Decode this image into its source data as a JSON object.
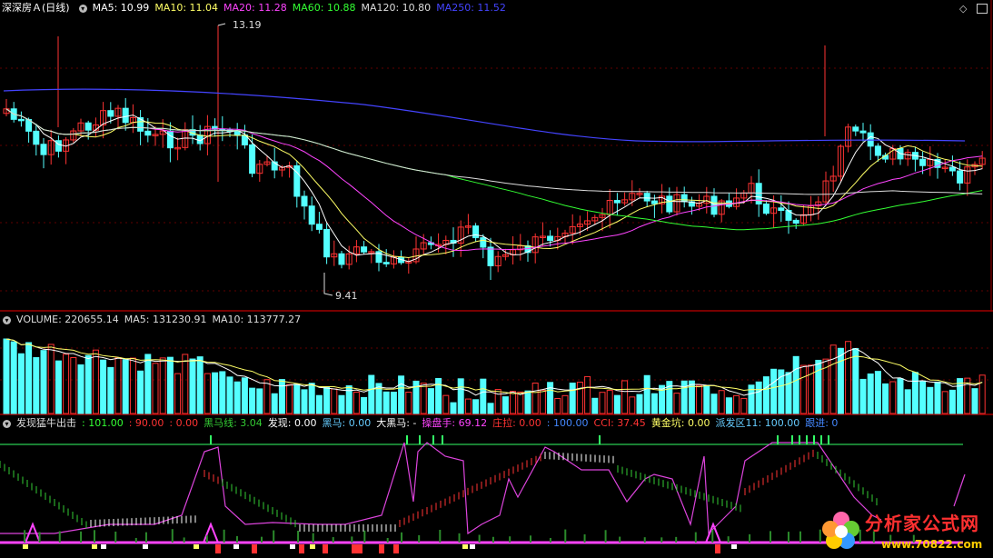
{
  "price_panel": {
    "title": "深深房Ａ(日线)",
    "indicators": [
      {
        "label": "MA5: 10.99",
        "color": "#ffffff"
      },
      {
        "label": "MA10: 11.04",
        "color": "#ffff66"
      },
      {
        "label": "MA20: 11.28",
        "color": "#ff44ff"
      },
      {
        "label": "MA60: 10.88",
        "color": "#33ff33"
      },
      {
        "label": "MA120: 10.80",
        "color": "#dddddd"
      },
      {
        "label": "MA250: 11.52",
        "color": "#4444ff"
      }
    ],
    "high_label": "13.19",
    "low_label": "9.41"
  },
  "volume_panel": {
    "indicators": [
      {
        "label": "VOLUME: 220655.14",
        "color": "#dddddd"
      },
      {
        "label": "MA5: 131230.91",
        "color": "#dddddd"
      },
      {
        "label": "MA10: 113777.27",
        "color": "#dddddd"
      }
    ]
  },
  "signal_panel": {
    "indicators": [
      {
        "label": "发现猛牛出击",
        "color": "#dddddd"
      },
      {
        "label": ": 101.00",
        "color": "#33ff33"
      },
      {
        "label": ": 90.00",
        "color": "#ff3333"
      },
      {
        "label": ": 0.00",
        "color": "#ff3333"
      },
      {
        "label": "黑马线: 3.04",
        "color": "#33cc33"
      },
      {
        "label": "发现: 0.00",
        "color": "#ffffff"
      },
      {
        "label": "黑马: 0.00",
        "color": "#66ccff"
      },
      {
        "label": "大黑马: -",
        "color": "#ffffff"
      },
      {
        "label": "操盘手: 69.12",
        "color": "#ff44ff"
      },
      {
        "label": "庄拉: 0.00",
        "color": "#ff3333"
      },
      {
        "label": ": 100.00",
        "color": "#4488ff"
      },
      {
        "label": "CCI: 37.45",
        "color": "#ff3333"
      },
      {
        "label": "黄金坑: 0.00",
        "color": "#ffff66"
      },
      {
        "label": "派发区11: 100.00",
        "color": "#66ccff"
      },
      {
        "label": "跟进: 0",
        "color": "#4488ff"
      }
    ]
  },
  "watermark": {
    "text": "分析家公式网",
    "url": "www.70822.com"
  },
  "colors": {
    "up": "#ff3333",
    "down": "#54ffff",
    "bg": "#000000",
    "border": "#a00000"
  },
  "icons": [
    "chevron-icon",
    "diamond-icon",
    "window-icon"
  ]
}
